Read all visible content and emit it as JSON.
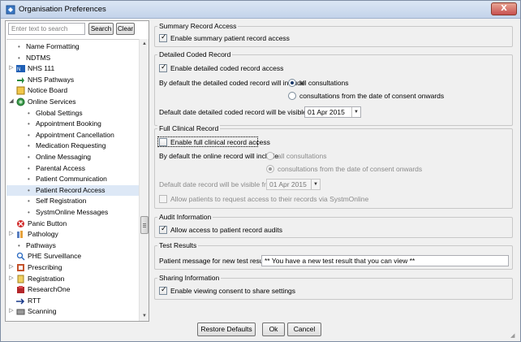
{
  "window": {
    "title": "Organisation Preferences",
    "close_label": "X"
  },
  "search": {
    "placeholder": "Enter text to search",
    "search_label": "Search",
    "clear_label": "Clear"
  },
  "tree": [
    {
      "label": "Name Formatting",
      "indent": 1,
      "icon": "bullet",
      "expander": ""
    },
    {
      "label": "NDTMS",
      "indent": 1,
      "icon": "bullet",
      "expander": ""
    },
    {
      "label": "NHS 111",
      "indent": 0,
      "icon": "nhs-icon",
      "expander": "▷"
    },
    {
      "label": "NHS Pathways",
      "indent": 0,
      "icon": "arrow-icon",
      "expander": ""
    },
    {
      "label": "Notice Board",
      "indent": 0,
      "icon": "notice-icon",
      "expander": ""
    },
    {
      "label": "Online Services",
      "indent": 0,
      "icon": "globe-icon",
      "expander": "◢"
    },
    {
      "label": "Global Settings",
      "indent": 2,
      "icon": "bullet",
      "expander": ""
    },
    {
      "label": "Appointment Booking",
      "indent": 2,
      "icon": "bullet",
      "expander": ""
    },
    {
      "label": "Appointment Cancellation",
      "indent": 2,
      "icon": "bullet",
      "expander": ""
    },
    {
      "label": "Medication Requesting",
      "indent": 2,
      "icon": "bullet",
      "expander": ""
    },
    {
      "label": "Online Messaging",
      "indent": 2,
      "icon": "bullet",
      "expander": ""
    },
    {
      "label": "Parental Access",
      "indent": 2,
      "icon": "bullet",
      "expander": ""
    },
    {
      "label": "Patient Communication",
      "indent": 2,
      "icon": "bullet",
      "expander": ""
    },
    {
      "label": "Patient Record Access",
      "indent": 2,
      "icon": "bullet",
      "expander": "",
      "selected": true
    },
    {
      "label": "Self Registration",
      "indent": 2,
      "icon": "bullet",
      "expander": ""
    },
    {
      "label": "SystmOnline Messages",
      "indent": 2,
      "icon": "bullet",
      "expander": ""
    },
    {
      "label": "Panic Button",
      "indent": 0,
      "icon": "panic-icon",
      "expander": ""
    },
    {
      "label": "Pathology",
      "indent": 0,
      "icon": "pathology-icon",
      "expander": "▷"
    },
    {
      "label": "Pathways",
      "indent": 1,
      "icon": "bullet",
      "expander": ""
    },
    {
      "label": "PHE Surveillance",
      "indent": 0,
      "icon": "magnifier-icon",
      "expander": ""
    },
    {
      "label": "Prescribing",
      "indent": 0,
      "icon": "prescribing-icon",
      "expander": "▷"
    },
    {
      "label": "Registration",
      "indent": 0,
      "icon": "registration-icon",
      "expander": "▷"
    },
    {
      "label": "ResearchOne",
      "indent": 0,
      "icon": "research-icon",
      "expander": ""
    },
    {
      "label": "RTT",
      "indent": 0,
      "icon": "rtt-icon",
      "expander": ""
    },
    {
      "label": "Scanning",
      "indent": 0,
      "icon": "scanning-icon",
      "expander": "▷"
    }
  ],
  "summary": {
    "legend": "Summary Record Access",
    "enable_label": "Enable summary patient record access",
    "enable_checked": true
  },
  "detailed": {
    "legend": "Detailed Coded Record",
    "enable_label": "Enable detailed coded record access",
    "enable_checked": true,
    "default_include_label": "By default the detailed coded record will include",
    "option_all": "all consultations",
    "option_consent": "consultations from the date of consent onwards",
    "selected": "all",
    "date_label": "Default date detailed coded record will be visible from",
    "date_value": "01 Apr 2015"
  },
  "full": {
    "legend": "Full Clinical Record",
    "enable_label": "Enable full clinical record access",
    "enable_checked": false,
    "default_include_label": "By default the online record will include",
    "option_all": "all consultations",
    "option_consent": "consultations from the date of consent onwards",
    "selected": "consent",
    "date_label": "Default date record will be visible from",
    "date_value": "01 Apr 2015",
    "request_label": "Allow patients to request access to their records via SystmOnline",
    "request_checked": false
  },
  "audit": {
    "legend": "Audit Information",
    "allow_label": "Allow access to patient record audits",
    "allow_checked": true
  },
  "tests": {
    "legend": "Test Results",
    "message_label": "Patient message for new test results",
    "message_value": "** You have a new test result that you can view **"
  },
  "sharing": {
    "legend": "Sharing Information",
    "enable_label": "Enable viewing consent to share settings",
    "enable_checked": true
  },
  "footer": {
    "restore_label": "Restore Defaults",
    "ok_label": "Ok",
    "cancel_label": "Cancel"
  },
  "colors": {
    "selected_row": "#dde8f6",
    "titlebar": "#c3d3ea",
    "close": "#c75050"
  }
}
